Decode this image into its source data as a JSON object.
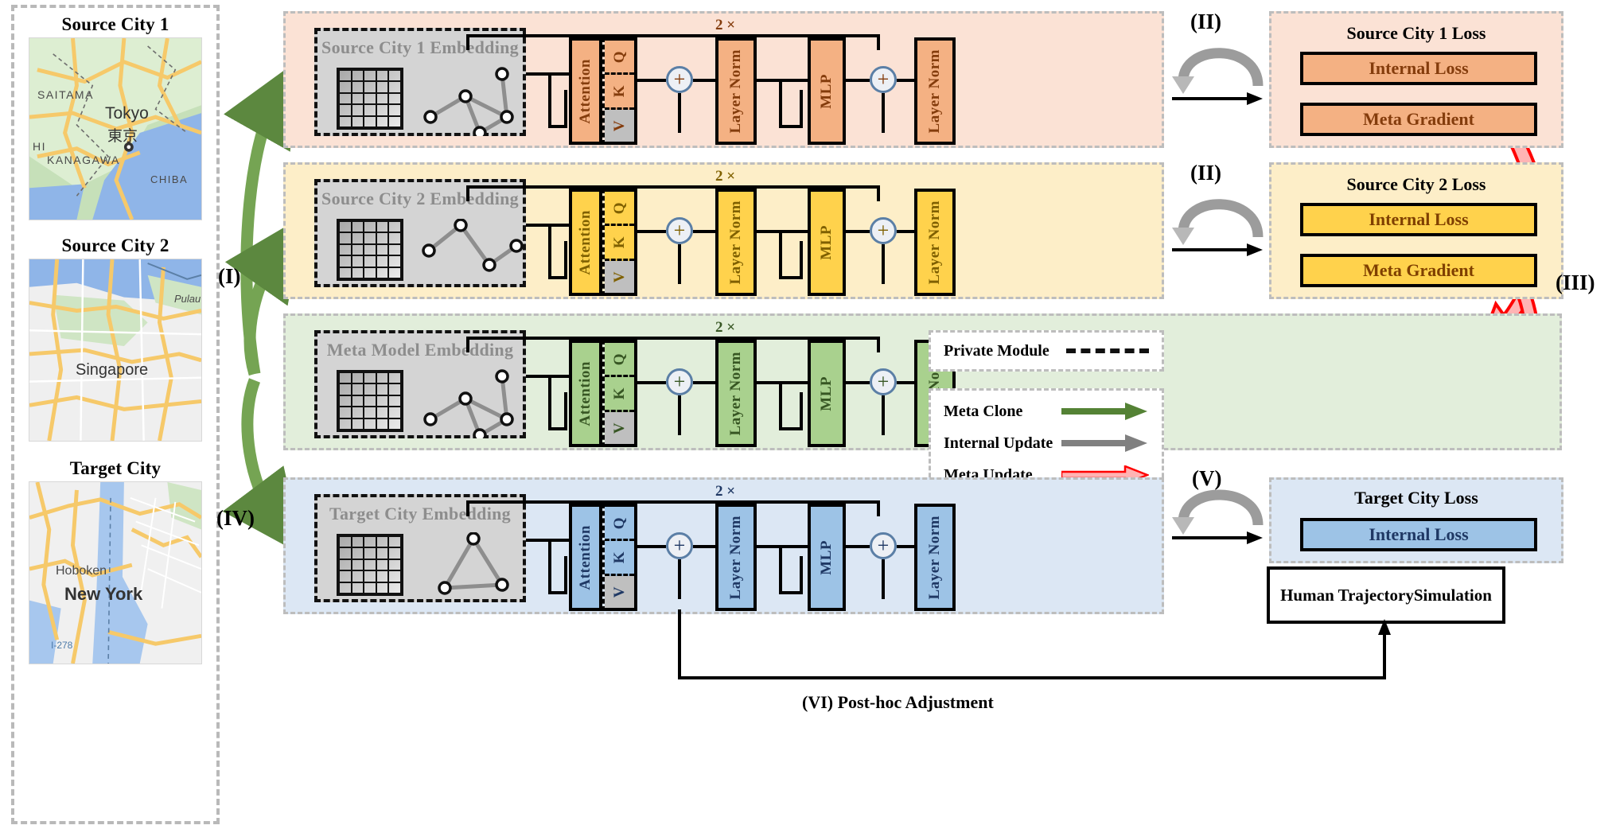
{
  "cities": [
    {
      "title": "Source City 1",
      "map_name": "Tokyo",
      "map_name_alt": "東京",
      "labels": [
        "SAITAMA",
        "HI",
        "KANAGAWA",
        "CHIBA"
      ]
    },
    {
      "title": "Source City 2",
      "map_name": "Singapore",
      "map_name_alt": "",
      "labels": [
        "Pulau"
      ]
    },
    {
      "title": "Target City",
      "map_name": "New York",
      "map_name_alt": "",
      "labels": [
        "Hoboken",
        "I-278"
      ]
    }
  ],
  "rows": [
    {
      "key": "source1",
      "embedding_title": "Source City 1 Embedding",
      "repeat_label": "2 ×",
      "blocks": [
        "Attention",
        "Layer Norm",
        "MLP",
        "Layer Norm"
      ],
      "qkv": [
        "Q",
        "K",
        "V"
      ],
      "plus": "+",
      "accent": "#F4B183",
      "band_bg": "#FBE2D5",
      "text_color": "#843C0C",
      "loss_title": "Source City 1 Loss",
      "loss_chips": [
        "Internal Loss",
        "Meta Gradient"
      ],
      "stage": "(II)"
    },
    {
      "key": "source2",
      "embedding_title": "Source City 2 Embedding",
      "repeat_label": "2 ×",
      "blocks": [
        "Attention",
        "Layer Norm",
        "MLP",
        "Layer Norm"
      ],
      "qkv": [
        "Q",
        "K",
        "V"
      ],
      "plus": "+",
      "accent": "#FFD24C",
      "band_bg": "#FDEEC8",
      "text_color": "#7F6000",
      "loss_title": "Source City 2 Loss",
      "loss_chips": [
        "Internal Loss",
        "Meta Gradient"
      ],
      "stage": "(II)"
    },
    {
      "key": "meta",
      "embedding_title": "Meta Model Embedding",
      "repeat_label": "2 ×",
      "blocks": [
        "Attention",
        "Layer Norm",
        "MLP",
        "Layer Norm"
      ],
      "qkv": [
        "Q",
        "K",
        "V"
      ],
      "plus": "+",
      "accent": "#A9D18E",
      "band_bg": "#E2EEDB",
      "text_color": "#375623",
      "loss_title": "",
      "loss_chips": [],
      "stage": ""
    },
    {
      "key": "target",
      "embedding_title": "Target City Embedding",
      "repeat_label": "2 ×",
      "blocks": [
        "Attention",
        "Layer Norm",
        "MLP",
        "Layer Norm"
      ],
      "qkv": [
        "Q",
        "K",
        "V"
      ],
      "plus": "+",
      "accent": "#9DC3E6",
      "band_bg": "#DCE7F4",
      "text_color": "#1F3864",
      "loss_title": "Target City Loss",
      "loss_chips": [
        "Internal Loss"
      ],
      "stage": "(V)"
    }
  ],
  "stages": {
    "i": "(I)",
    "ii_row1": "(II)",
    "ii_row2": "(II)",
    "iii": "(III)",
    "iv": "(IV)",
    "v": "(V)",
    "vi": "(VI) Post-hoc Adjustment"
  },
  "legend": {
    "private_module": "Private Module",
    "arrows": [
      {
        "label": "Meta Clone",
        "color": "#548235"
      },
      {
        "label": "Internal Update",
        "color": "#808080"
      },
      {
        "label": "Meta Update",
        "color": "#FF0000"
      }
    ]
  },
  "simulation_box": {
    "line1": "Human Trajectory",
    "line2": "Simulation"
  },
  "colors": {
    "panel_dash": "#BDBDBD",
    "meta_clone_green": "#548235",
    "internal_gray": "#808080",
    "meta_red": "#FF0000"
  }
}
